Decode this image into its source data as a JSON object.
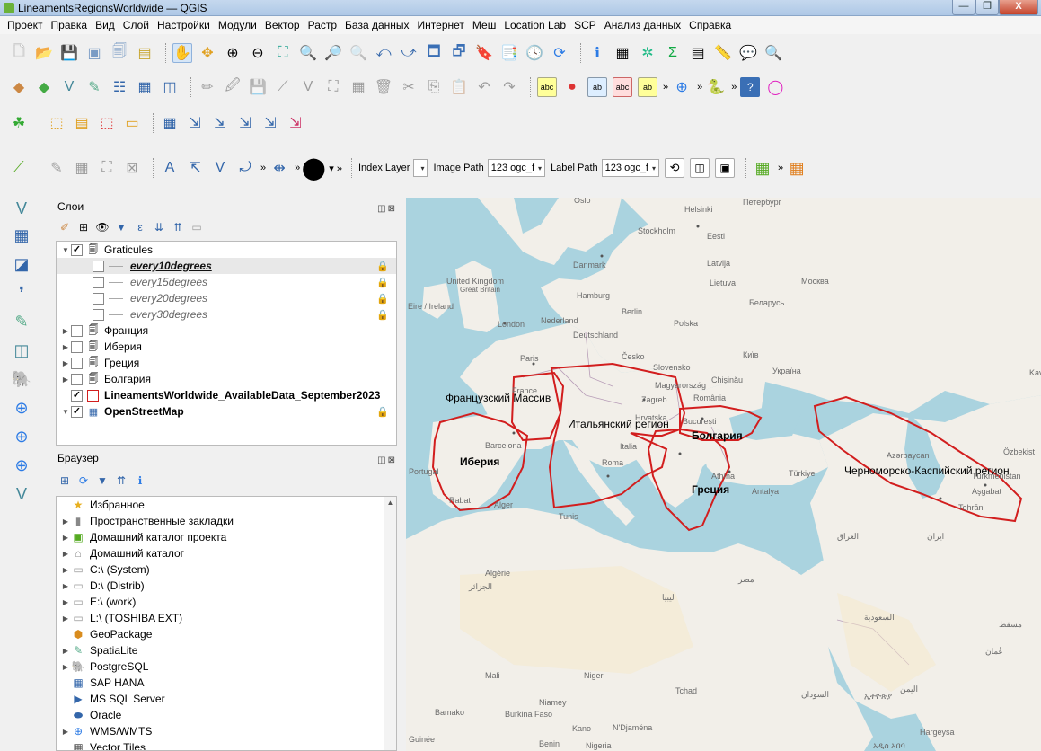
{
  "window": {
    "title": "LineamentsRegionsWorldwide — QGIS",
    "min": "—",
    "max": "❐",
    "close": "X"
  },
  "menu": [
    "Проект",
    "Правка",
    "Вид",
    "Слой",
    "Настройки",
    "Модули",
    "Вектор",
    "Растр",
    "База данных",
    "Интернет",
    "Меш",
    "Location Lab",
    "SCP",
    "Анализ данных",
    "Справка"
  ],
  "toolbar4": {
    "index_layer_label": "Index Layer",
    "image_path_label": "Image Path",
    "image_path_value": "123 ogc_f",
    "label_path_label": "Label Path",
    "label_path_value": "123 ogc_f"
  },
  "layers_panel": {
    "title": "Слои",
    "items": [
      {
        "name": "Graticules",
        "checked": true
      },
      {
        "name": "every10degrees"
      },
      {
        "name": "every15degrees"
      },
      {
        "name": "every20degrees"
      },
      {
        "name": "every30degrees"
      },
      {
        "name": "Франция",
        "checked": false
      },
      {
        "name": "Иберия",
        "checked": false
      },
      {
        "name": "Греция",
        "checked": false
      },
      {
        "name": "Болгария",
        "checked": false
      },
      {
        "name": "LineamentsWorldwide_AvailableData_September2023",
        "checked": true
      },
      {
        "name": "OpenStreetMap",
        "checked": true
      }
    ]
  },
  "browser_panel": {
    "title": "Браузер",
    "items": [
      "Избранное",
      "Пространственные закладки",
      "Домашний каталог проекта",
      "Домашний каталог",
      "C:\\ (System)",
      "D:\\ (Distrib)",
      "E:\\ (work)",
      "L:\\ (TOSHIBA EXT)",
      "GeoPackage",
      "SpatiaLite",
      "PostgreSQL",
      "SAP HANA",
      "MS SQL Server",
      "Oracle",
      "WMS/WMTS",
      "Vector Tiles"
    ]
  },
  "map": {
    "region_labels": [
      "Французский Массив",
      "Итальянский регион",
      "Болгария",
      "Иберия",
      "Греция",
      "Черноморско-Каспийский регион"
    ],
    "base_labels": [
      "Oslo",
      "Helsinki",
      "Петербург",
      "Stockholm",
      "Eesti",
      "Latvija",
      "Danmark",
      "United Kingdom",
      "Great Britain",
      "Lietuva",
      "Москва",
      "Hamburg",
      "Eire / Ireland",
      "Беларусь",
      "Berlin",
      "London",
      "Nederland",
      "Polska",
      "Deutschland",
      "Česko",
      "Київ",
      "Paris",
      "Slovensko",
      "Україна",
      "France",
      "Magyarország",
      "Chișinău",
      "Zagreb",
      "România",
      "Hrvatska",
      "București",
      "Barcelona",
      "Italia",
      "Portugal",
      "Roma",
      "Türkiye",
      "Athína",
      "Antalya",
      "Rabat",
      "Alger",
      "Tunis",
      "Tehrān",
      "Aşgabat",
      "Algérie",
      "مصر",
      "Mali",
      "Niger",
      "Tchad",
      "Niamey",
      "Bamako",
      "Burkina Faso",
      "N'Djaména",
      "Nigeria",
      "Benin",
      "Guinée",
      "Kano",
      "Hargeysa",
      "Kav",
      "Özbekist",
      "Azərbaycan",
      "Türkmenistan",
      "السودان",
      "ليبيا",
      "الجزائر",
      "العراق",
      "ایران",
      "السعودية",
      "مسقط",
      "عُمان",
      "اليمن",
      "ኢትዮጵያ",
      "አዲስ አበባ"
    ]
  }
}
